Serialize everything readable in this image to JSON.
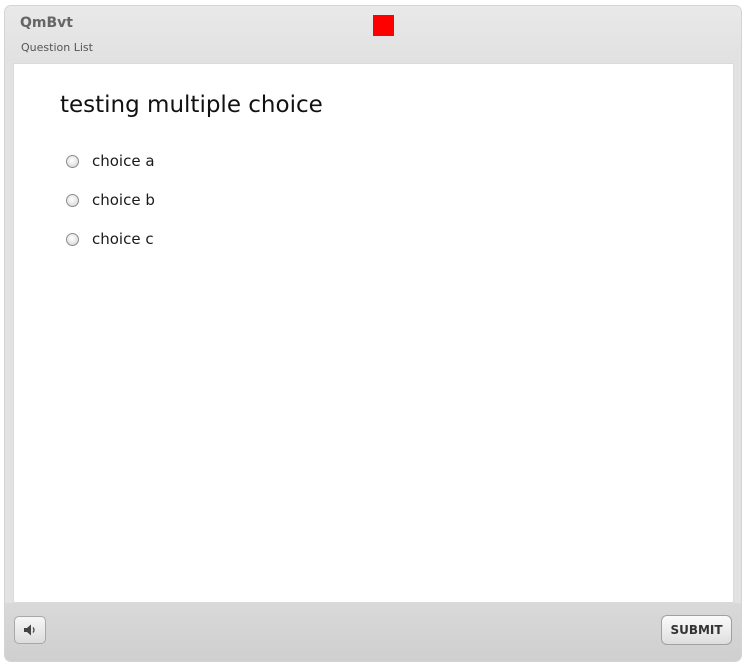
{
  "header": {
    "title": "QmBvt",
    "subtitle": "Question List",
    "marker_color": "#ff0000"
  },
  "question": {
    "text": "testing multiple choice",
    "choices": [
      "choice a",
      "choice b",
      "choice c"
    ]
  },
  "footer": {
    "audio_icon": "speaker-icon",
    "submit_label": "SUBMIT"
  }
}
